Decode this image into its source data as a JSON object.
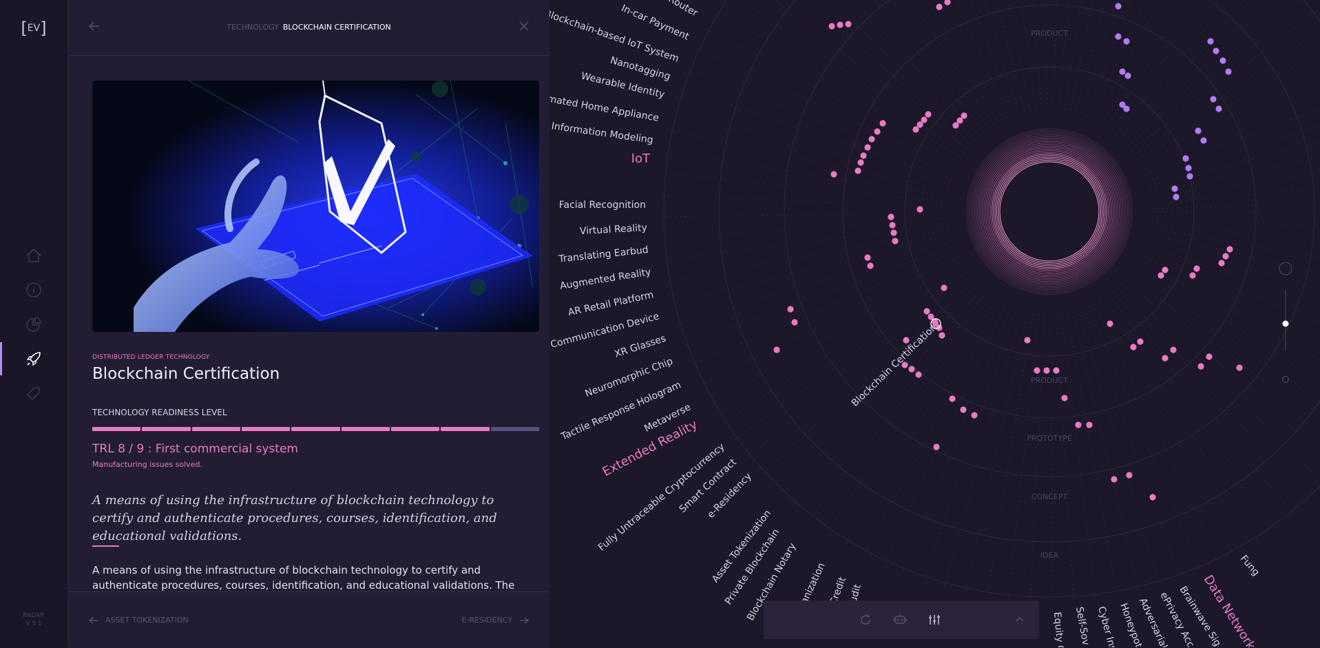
{
  "app": {
    "logo_text": "EV",
    "version": "RADAR\nV 5.1"
  },
  "nav": [
    {
      "name": "home-icon"
    },
    {
      "name": "info-icon"
    },
    {
      "name": "pie-chart-icon"
    },
    {
      "name": "rocket-icon",
      "active": true
    },
    {
      "name": "tag-icon"
    }
  ],
  "header": {
    "breadcrumb_parent": "TECHNOLOGY",
    "breadcrumb_current": "BLOCKCHAIN CERTIFICATION"
  },
  "detail": {
    "category": "DISTRIBUTED LEDGER TECHNOLOGY",
    "title": "Blockchain Certification",
    "trl_label": "TECHNOLOGY READINESS LEVEL",
    "trl_level": 8,
    "trl_max": 9,
    "trl_value": "TRL 8 / 9 : First commercial system",
    "trl_sub": "Manufacturing issues solved.",
    "summary": "A means of using the infrastructure of blockchain technology to certify and authenticate procedures, courses, identification, and educational validations.",
    "body": "A means of using the infrastructure of blockchain technology to certify and authenticate procedures, courses, identification, and educational validations. The process begins with the"
  },
  "footer": {
    "prev_label": "ASSET TOKENIZATION",
    "next_label": "E-RESIDENCY"
  },
  "radar": {
    "rings": [
      "PRODUCT",
      "PRODUCT",
      "PROTOTYPE",
      "CONCEPT",
      "IDEA"
    ],
    "categories": [
      "IoT",
      "Extended Reality",
      "Data Network"
    ],
    "iot_items": [
      "IoT Router",
      "In-car Payment",
      "Blockchain-based IoT System",
      "Nanotagging",
      "Wearable Identity",
      "Automated Home Appliance",
      "City Information Modeling"
    ],
    "xr_items": [
      "Facial Recognition",
      "Virtual Reality",
      "Translating Earbud",
      "Augmented Reality",
      "AR Retail Platform",
      "Haptic Communication Device",
      "XR Glasses",
      "Neuromorphic Chip",
      "Tactile Response Hologram",
      "Metaverse"
    ],
    "dlt_items": [
      "Fully Untraceable Cryptocurrency",
      "Smart Contract",
      "e-Residency",
      "Asset Tokenization",
      "Private Blockchain",
      "Blockchain Notary",
      "Organization",
      "Credit",
      "Audit"
    ],
    "dn_items": [
      "Equity C",
      "Self-Sov",
      "Cyber Ins",
      "Honeypot",
      "Adversarial",
      "ePrivacy Acc",
      "Brainwave Sig",
      "Fung"
    ],
    "selected_label": "Blockchain Certification",
    "colors": {
      "accent": "#e87bc4",
      "violet": "#b07cf0",
      "bg": "#1c1729"
    }
  },
  "toolbar": [
    {
      "name": "reset-icon"
    },
    {
      "name": "filter-icon"
    },
    {
      "name": "sliders-icon"
    },
    {
      "name": "chevron-up-icon"
    }
  ]
}
